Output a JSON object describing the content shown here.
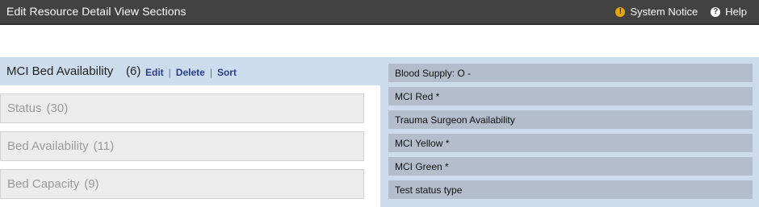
{
  "header": {
    "title": "Edit Resource Detail View Sections",
    "system_notice_label": "System Notice",
    "help_label": "Help",
    "system_notice_icon": "!",
    "help_icon": "?"
  },
  "selected_section": {
    "name": "MCI Bed Availability",
    "count": "(6)",
    "edit_label": "Edit",
    "delete_label": "Delete",
    "sort_label": "Sort",
    "separator": "|"
  },
  "sections": [
    {
      "name": "Status",
      "count": "(30)"
    },
    {
      "name": "Bed Availability",
      "count": "(11)"
    },
    {
      "name": "Bed Capacity",
      "count": "(9)"
    }
  ],
  "fields": [
    {
      "label": "Blood Supply: O -"
    },
    {
      "label": "MCI Red *"
    },
    {
      "label": "Trauma Surgeon Availability"
    },
    {
      "label": "MCI Yellow *"
    },
    {
      "label": "MCI Green *"
    },
    {
      "label": "Test status type"
    }
  ],
  "colors": {
    "header_bg": "#424242",
    "panel_bg": "#ccdcec",
    "field_bg": "#b3bdcc",
    "section_bg": "#ececec",
    "link": "#2a3d8a",
    "notice": "#e7a700"
  }
}
